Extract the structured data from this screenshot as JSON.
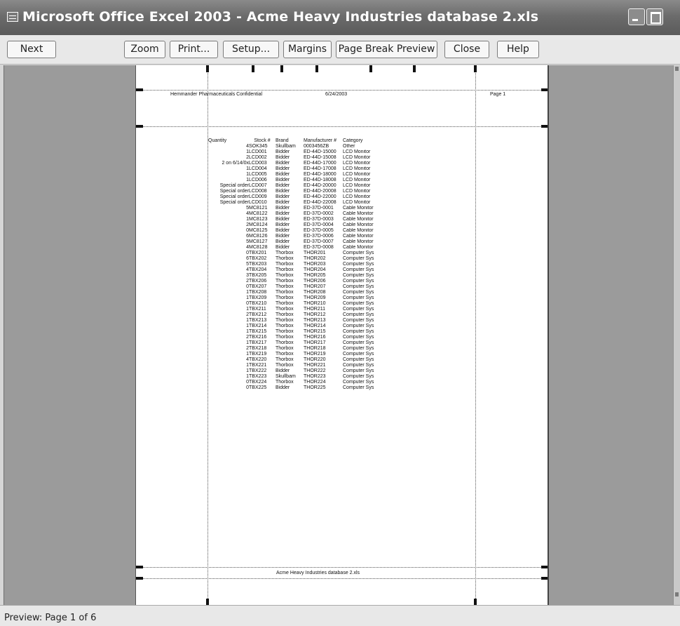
{
  "window": {
    "title": "Microsoft Office Excel 2003 - Acme Heavy Industries database 2.xls"
  },
  "toolbar": {
    "buttons": [
      "Next",
      "Zoom",
      "Print...",
      "Setup...",
      "Margins",
      "Page Break Preview",
      "Close",
      "Help"
    ]
  },
  "page": {
    "header_left": "Hemmander Pharmaceuticals Confidential",
    "header_date": "6/24/2003",
    "header_right": "Page 1",
    "footer": "Acme Heavy Industries database 2.xls",
    "columns": [
      "Quantity",
      "Stock #",
      "Brand",
      "Manufacturer #",
      "Category"
    ],
    "rows": [
      [
        "4",
        "SOK345",
        "Skullbam",
        "0003456ZB",
        "Other"
      ],
      [
        "1",
        "LCD001",
        "Bidder",
        "ED-44D-15000",
        "LCD Monitor"
      ],
      [
        "2",
        "LCD002",
        "Bidder",
        "ED-44D-15008",
        "LCD Monitor"
      ],
      [
        "2 on 6/14/0x",
        "LCD003",
        "Bidder",
        "ED-44D-17000",
        "LCD Monitor"
      ],
      [
        "1",
        "LCD004",
        "Bidder",
        "ED-44D-17008",
        "LCD Monitor"
      ],
      [
        "1",
        "LCD005",
        "Bidder",
        "ED-44D-18000",
        "LCD Monitor"
      ],
      [
        "1",
        "LCD006",
        "Bidder",
        "ED-44D-18008",
        "LCD Monitor"
      ],
      [
        "Special order",
        "LCD007",
        "Bidder",
        "ED-44D-20000",
        "LCD Monitor"
      ],
      [
        "Special order",
        "LCD008",
        "Bidder",
        "ED-44D-20008",
        "LCD Monitor"
      ],
      [
        "Special order",
        "LCD009",
        "Bidder",
        "ED-44D-22000",
        "LCD Monitor"
      ],
      [
        "Special order",
        "LCD010",
        "Bidder",
        "ED-44D-22008",
        "LCD Monitor"
      ],
      [
        "5",
        "MC8121",
        "Bidder",
        "ED-37D-0001",
        "Cable Monitor"
      ],
      [
        "4",
        "MC8122",
        "Bidder",
        "ED-37D-0002",
        "Cable Monitor"
      ],
      [
        "1",
        "MC8123",
        "Bidder",
        "ED-37D-0003",
        "Cable Monitor"
      ],
      [
        "2",
        "MC8124",
        "Bidder",
        "ED-37D-0004",
        "Cable Monitor"
      ],
      [
        "0",
        "MC8125",
        "Bidder",
        "ED-37D-0005",
        "Cable Monitor"
      ],
      [
        "6",
        "MC8126",
        "Bidder",
        "ED-37D-0006",
        "Cable Monitor"
      ],
      [
        "5",
        "MC8127",
        "Bidder",
        "ED-37D-0007",
        "Cable Monitor"
      ],
      [
        "4",
        "MC8128",
        "Bidder",
        "ED-37D-0008",
        "Cable Monitor"
      ],
      [
        "0",
        "TBX201",
        "Thorbox",
        "THOR201",
        "Computer Sys"
      ],
      [
        "6",
        "TBX202",
        "Thorbox",
        "THOR202",
        "Computer Sys"
      ],
      [
        "5",
        "TBX203",
        "Thorbox",
        "THOR203",
        "Computer Sys"
      ],
      [
        "4",
        "TBX204",
        "Thorbox",
        "THOR204",
        "Computer Sys"
      ],
      [
        "3",
        "TBX205",
        "Thorbox",
        "THOR205",
        "Computer Sys"
      ],
      [
        "2",
        "TBX206",
        "Thorbox",
        "THOR206",
        "Computer Sys"
      ],
      [
        "0",
        "TBX207",
        "Thorbox",
        "THOR207",
        "Computer Sys"
      ],
      [
        "1",
        "TBX208",
        "Thorbox",
        "THOR208",
        "Computer Sys"
      ],
      [
        "1",
        "TBX209",
        "Thorbox",
        "THOR209",
        "Computer Sys"
      ],
      [
        "0",
        "TBX210",
        "Thorbox",
        "THOR210",
        "Computer Sys"
      ],
      [
        "1",
        "TBX211",
        "Thorbox",
        "THOR211",
        "Computer Sys"
      ],
      [
        "2",
        "TBX212",
        "Thorbox",
        "THOR212",
        "Computer Sys"
      ],
      [
        "1",
        "TBX213",
        "Thorbox",
        "THOR213",
        "Computer Sys"
      ],
      [
        "1",
        "TBX214",
        "Thorbox",
        "THOR214",
        "Computer Sys"
      ],
      [
        "1",
        "TBX215",
        "Thorbox",
        "THOR215",
        "Computer Sys"
      ],
      [
        "2",
        "TBX216",
        "Thorbox",
        "THOR216",
        "Computer Sys"
      ],
      [
        "1",
        "TBX217",
        "Thorbox",
        "THOR217",
        "Computer Sys"
      ],
      [
        "2",
        "TBX218",
        "Thorbox",
        "THOR218",
        "Computer Sys"
      ],
      [
        "1",
        "TBX219",
        "Thorbox",
        "THOR219",
        "Computer Sys"
      ],
      [
        "4",
        "TBX220",
        "Thorbox",
        "THOR220",
        "Computer Sys"
      ],
      [
        "1",
        "TBX221",
        "Thorbox",
        "THOR221",
        "Computer Sys"
      ],
      [
        "1",
        "TBX222",
        "Bidder",
        "THOR222",
        "Computer Sys"
      ],
      [
        "1",
        "TBX223",
        "Skullbam",
        "THOR223",
        "Computer Sys"
      ],
      [
        "0",
        "TBX224",
        "Thorbox",
        "THOR224",
        "Computer Sys"
      ],
      [
        "0",
        "TBX225",
        "Bidder",
        "THOR225",
        "Computer Sys"
      ]
    ]
  },
  "status": {
    "text": "Preview: Page 1 of 6"
  }
}
